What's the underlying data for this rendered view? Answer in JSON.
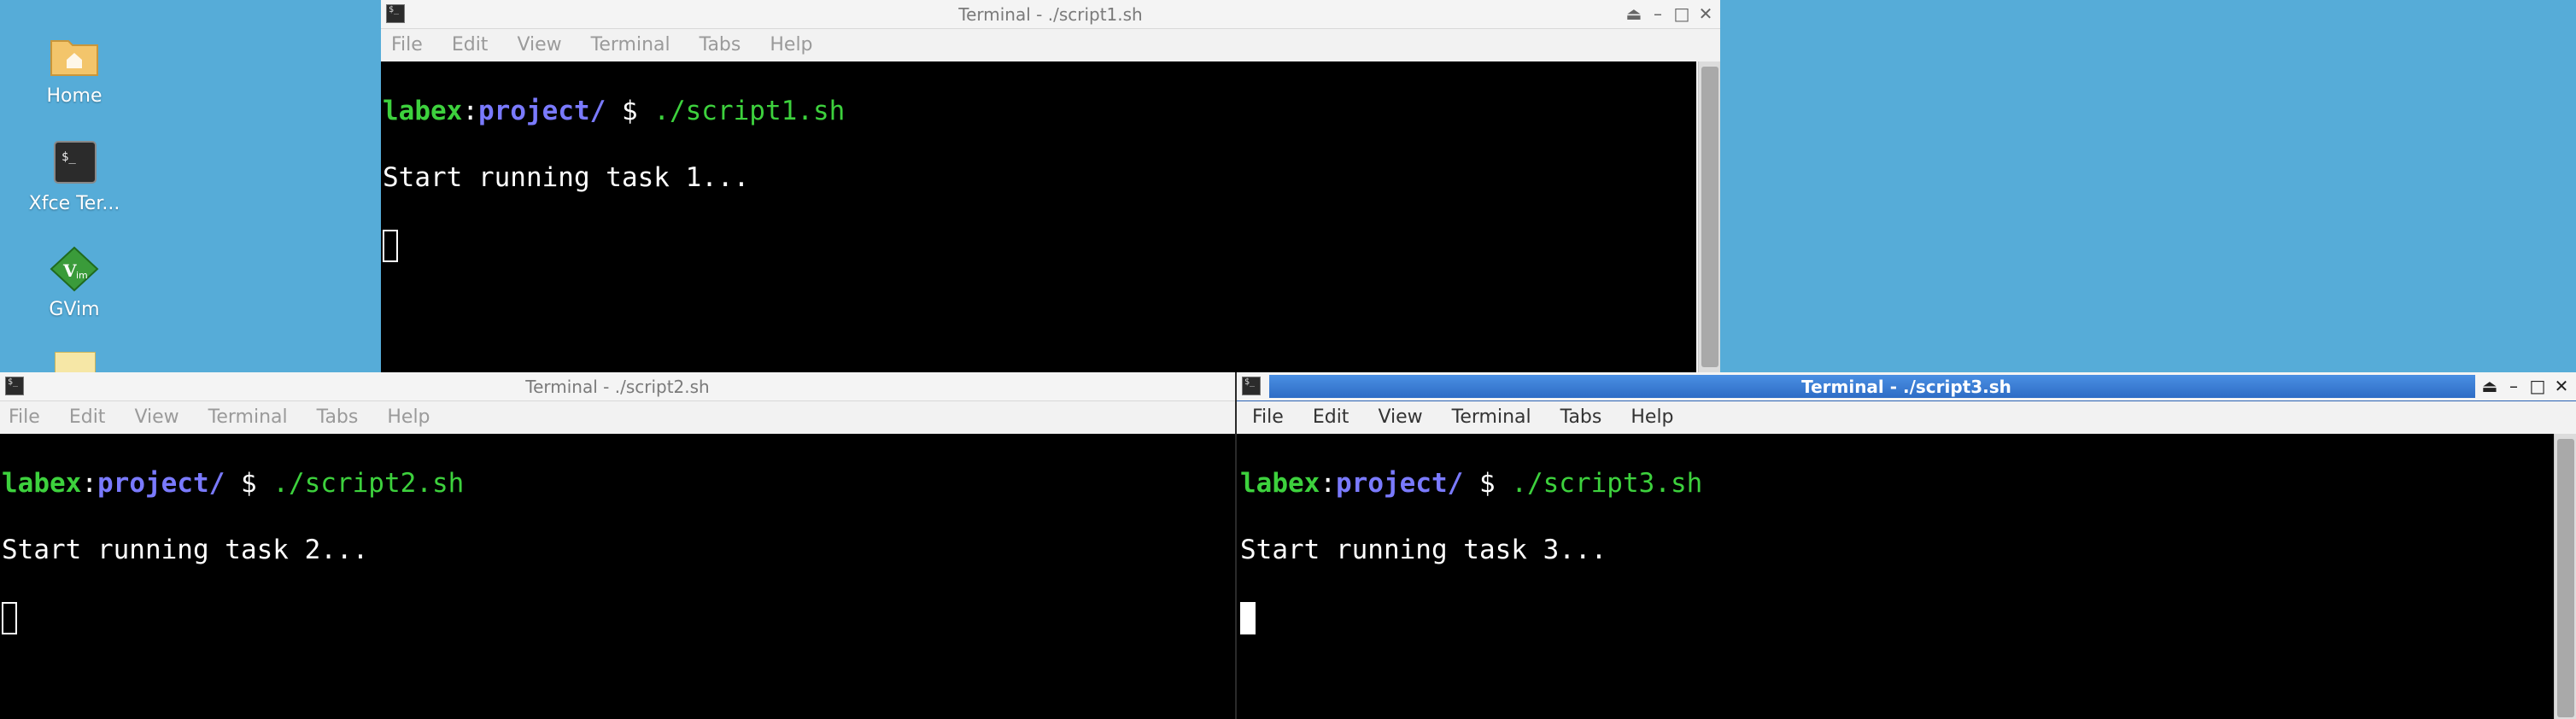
{
  "desktop": {
    "icons": [
      {
        "label": "Home",
        "icon": "home-folder-icon"
      },
      {
        "label": "Xfce Ter...",
        "icon": "terminal-icon"
      },
      {
        "label": "GVim",
        "icon": "gvim-icon"
      }
    ]
  },
  "menu": [
    "File",
    "Edit",
    "View",
    "Terminal",
    "Tabs",
    "Help"
  ],
  "windows": [
    {
      "title": "Terminal - ./script1.sh",
      "prompt": {
        "user": "labex",
        "sep": ":",
        "path": "project/",
        "dollar": " $ ",
        "command": "./script1.sh"
      },
      "output": "Start running task 1..."
    },
    {
      "title": "Terminal - ./script2.sh",
      "prompt": {
        "user": "labex",
        "sep": ":",
        "path": "project/",
        "dollar": " $ ",
        "command": "./script2.sh"
      },
      "output": "Start running task 2..."
    },
    {
      "title": "Terminal - ./script3.sh",
      "prompt": {
        "user": "labex",
        "sep": ":",
        "path": "project/",
        "dollar": " $ ",
        "command": "./script3.sh"
      },
      "output": "Start running task 3..."
    }
  ],
  "colors": {
    "desktop": "#56acd8",
    "active_title": "#3f86de",
    "prompt_user": "#3dd13d",
    "prompt_path": "#7a7aff"
  }
}
